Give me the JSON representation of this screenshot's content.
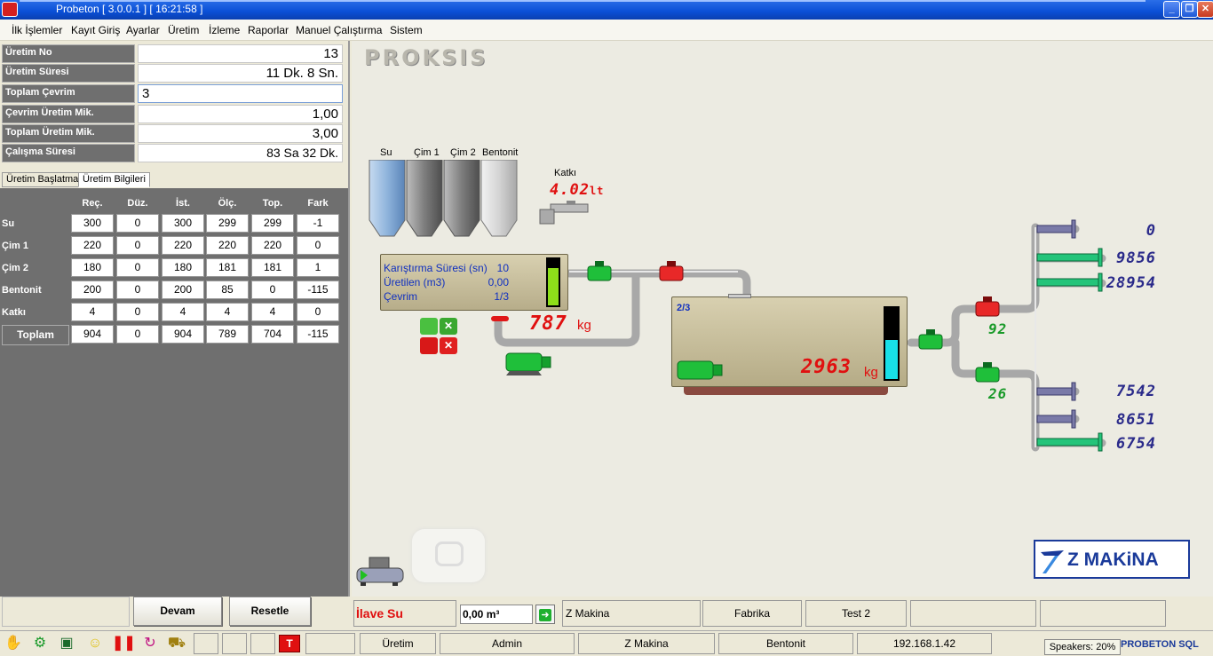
{
  "window": {
    "title": "Probeton [ 3.0.0.1 ] [ 16:21:58 ]"
  },
  "menu": [
    "İlk İşlemler",
    "Kayıt Giriş",
    "Ayarlar",
    "Üretim",
    "İzleme",
    "Raporlar",
    "Manuel Çalıştırma",
    "Sistem"
  ],
  "info": [
    {
      "label": "Üretim No",
      "value": "13"
    },
    {
      "label": "Üretim Süresi",
      "value": "11 Dk.  8 Sn."
    },
    {
      "label": "Toplam Çevrim",
      "value": "3"
    },
    {
      "label": "Çevrim Üretim Mik.",
      "value": "1,00"
    },
    {
      "label": "Toplam Üretim Mik.",
      "value": "3,00"
    },
    {
      "label": "Çalışma Süresi",
      "value": "83 Sa 32 Dk."
    }
  ],
  "tabs": [
    "Üretim Başlatma",
    "Üretim Bilgileri"
  ],
  "table": {
    "headers": [
      "Reç.",
      "Düz.",
      "İst.",
      "Ölç.",
      "Top.",
      "Fark"
    ],
    "rows": [
      {
        "name": "Su",
        "values": [
          "300",
          "0",
          "300",
          "299",
          "299",
          "-1"
        ]
      },
      {
        "name": "Çim 1",
        "values": [
          "220",
          "0",
          "220",
          "220",
          "220",
          "0"
        ]
      },
      {
        "name": "Çim 2",
        "values": [
          "180",
          "0",
          "180",
          "181",
          "181",
          "1"
        ]
      },
      {
        "name": "Bentonit",
        "values": [
          "200",
          "0",
          "200",
          "85",
          "0",
          "-115"
        ]
      },
      {
        "name": "Katkı",
        "values": [
          "4",
          "0",
          "4",
          "4",
          "4",
          "0"
        ]
      }
    ],
    "total": {
      "name": "Toplam",
      "values": [
        "904",
        "0",
        "904",
        "789",
        "704",
        "-115"
      ]
    }
  },
  "buttons": {
    "devam": "Devam",
    "resetle": "Resetle"
  },
  "scada": {
    "logo": "PROKSIS",
    "silos": [
      {
        "label": "Su",
        "color": "#8fb4dc"
      },
      {
        "label": "Çim 1",
        "color": "#8a8a8a"
      },
      {
        "label": "Çim 2",
        "color": "#8a8a8a"
      },
      {
        "label": "Bentonit",
        "color": "#d8d8d8"
      }
    ],
    "katki": {
      "label": "Katkı",
      "value": "4.02",
      "unit": "lt"
    },
    "mixer_panel": {
      "rows": [
        {
          "label": "Karıştırma Süresi (sn)",
          "value": "10"
        },
        {
          "label": "Üretilen (m3)",
          "value": "0,00"
        },
        {
          "label": "Çevrim",
          "value": "1/3"
        }
      ],
      "level": 0.8
    },
    "scale1": {
      "value": "787",
      "unit": "kg"
    },
    "tank": {
      "label": "2/3",
      "value": "2963",
      "unit": "kg",
      "level": 0.55
    },
    "valve_labels": {
      "upper": "92",
      "lower": "26"
    },
    "outputs": [
      "0",
      "9856",
      "28954",
      "7542",
      "8651",
      "6754"
    ],
    "brand": "Z MAKiNA"
  },
  "infobar": {
    "ilave_label": "İlave Su",
    "ilave_value": "0,00 m³",
    "fields": [
      "Z Makina",
      "Fabrika",
      "Test 2",
      "",
      ""
    ]
  },
  "statusbar": {
    "fields": [
      "Üretim",
      "Admin",
      "Z Makina",
      "Bentonit",
      "192.168.1.42"
    ],
    "speakers": "Speakers: 20%",
    "brand_logo": "PROBETON SQL"
  }
}
